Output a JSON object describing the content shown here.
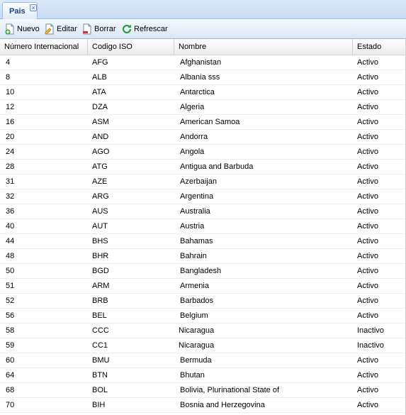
{
  "tab": {
    "label": "Pais"
  },
  "toolbar": {
    "nuevo": "Nuevo",
    "editar": "Editar",
    "borrar": "Borrar",
    "refrescar": "Refrescar"
  },
  "columns": [
    "Número Internacional",
    "Codigo ISO",
    "Nombre",
    "Estado"
  ],
  "rows": [
    [
      "4",
      "AFG",
      "Afghanistan",
      "Activo"
    ],
    [
      "8",
      "ALB",
      "Albania sss",
      "Activo"
    ],
    [
      "10",
      "ATA",
      "Antarctica",
      "Activo"
    ],
    [
      "12",
      "DZA",
      "Algeria",
      "Activo"
    ],
    [
      "16",
      "ASM",
      "American Samoa",
      "Activo"
    ],
    [
      "20",
      "AND",
      "Andorra",
      "Activo"
    ],
    [
      "24",
      "AGO",
      "Angola",
      "Activo"
    ],
    [
      "28",
      "ATG",
      "Antigua and Barbuda",
      "Activo"
    ],
    [
      "31",
      "AZE",
      "Azerbaijan",
      "Activo"
    ],
    [
      "32",
      "ARG",
      "Argentina",
      "Activo"
    ],
    [
      "36",
      "AUS",
      "Australia",
      "Activo"
    ],
    [
      "40",
      "AUT",
      "Austria",
      "Activo"
    ],
    [
      "44",
      "BHS",
      "Bahamas",
      "Activo"
    ],
    [
      "48",
      "BHR",
      "Bahrain",
      "Activo"
    ],
    [
      "50",
      "BGD",
      "Bangladesh",
      "Activo"
    ],
    [
      "51",
      "ARM",
      "Armenia",
      "Activo"
    ],
    [
      "52",
      "BRB",
      "Barbados",
      "Activo"
    ],
    [
      "56",
      "BEL",
      "Belgium",
      "Activo"
    ],
    [
      "58",
      "CCC",
      "Nicaragua",
      "Inactivo"
    ],
    [
      "59",
      "CC1",
      "Nicaragua",
      "Inactivo"
    ],
    [
      "60",
      "BMU",
      "Bermuda",
      "Activo"
    ],
    [
      "64",
      "BTN",
      "Bhutan",
      "Activo"
    ],
    [
      "68",
      "BOL",
      "Bolivia, Plurinational State of",
      "Activo"
    ],
    [
      "70",
      "BIH",
      "Bosnia and Herzegovina",
      "Activo"
    ]
  ]
}
